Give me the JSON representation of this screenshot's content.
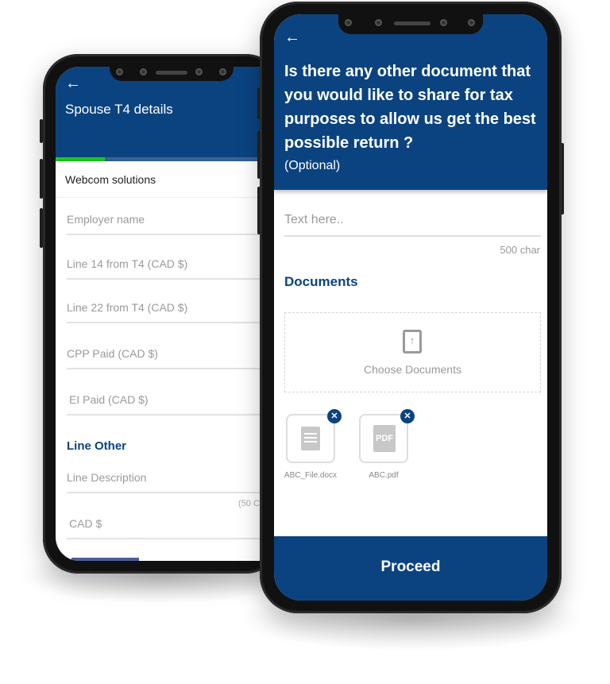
{
  "colors": {
    "brand": "#0b4380",
    "progress": "#1ed61e",
    "link": "#0b4380"
  },
  "back_phone": {
    "back_icon": "arrow-left-icon",
    "title": "Spouse T4 details",
    "progress_percent": 23,
    "company": "Webcom solutions",
    "fields": [
      "Employer name",
      "Line 14 from T4 (CAD $)",
      "Line 22 from T4 (CAD $)",
      "CPP Paid (CAD $)",
      "EI Paid (CAD $)"
    ],
    "section_title": "Line Other",
    "line_description": "Line Description",
    "char_hint": "(50 C",
    "amount_placeholder": "CAD $"
  },
  "front_phone": {
    "back_icon": "arrow-left-icon",
    "question": "Is there any other document that you would like to share for tax purposes to allow us get the best possible return ?",
    "optional": "(Optional)",
    "text_placeholder": "Text here..",
    "char_limit": "500 char",
    "documents_title": "Documents",
    "choose_documents": "Choose Documents",
    "files": [
      {
        "name": "ABC_File.docx",
        "icon": "doc-file-icon"
      },
      {
        "name": "ABC.pdf",
        "icon": "pdf-file-icon"
      }
    ],
    "proceed": "Proceed"
  }
}
